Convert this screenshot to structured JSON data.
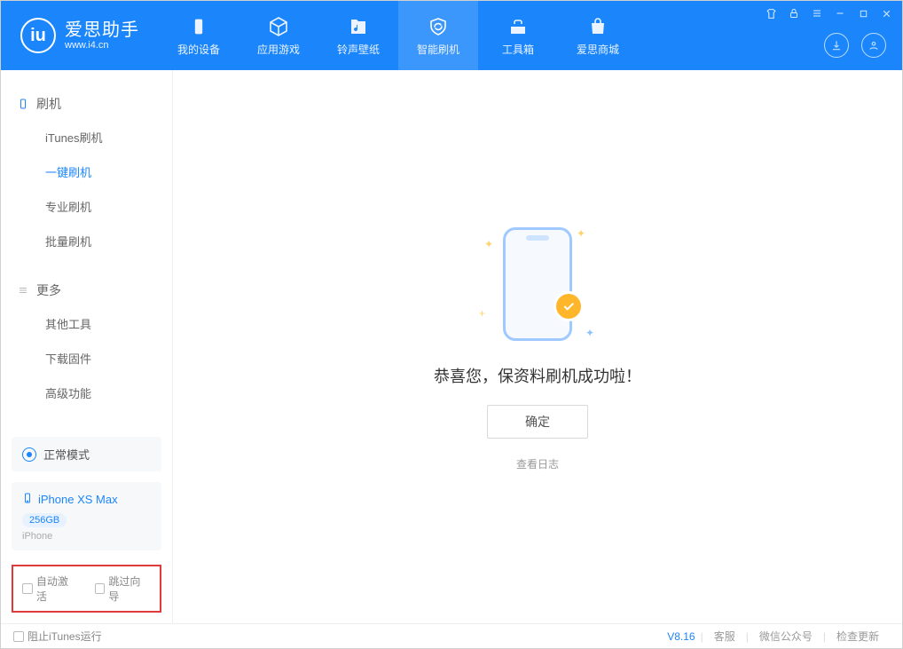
{
  "app": {
    "name_cn": "爱思助手",
    "name_en": "www.i4.cn"
  },
  "nav": {
    "items": [
      {
        "label": "我的设备"
      },
      {
        "label": "应用游戏"
      },
      {
        "label": "铃声壁纸"
      },
      {
        "label": "智能刷机"
      },
      {
        "label": "工具箱"
      },
      {
        "label": "爱思商城"
      }
    ],
    "active_index": 3
  },
  "sidebar": {
    "group1_title": "刷机",
    "group1_items": [
      "iTunes刷机",
      "一键刷机",
      "专业刷机",
      "批量刷机"
    ],
    "group1_active_index": 1,
    "group2_title": "更多",
    "group2_items": [
      "其他工具",
      "下载固件",
      "高级功能"
    ]
  },
  "mode": {
    "label": "正常模式"
  },
  "device": {
    "name": "iPhone XS Max",
    "capacity": "256GB",
    "type": "iPhone"
  },
  "options": {
    "auto_activate": "自动激活",
    "skip_guide": "跳过向导"
  },
  "main": {
    "success_text": "恭喜您，保资料刷机成功啦！",
    "ok_button": "确定",
    "view_log": "查看日志"
  },
  "footer": {
    "block_itunes": "阻止iTunes运行",
    "version": "V8.16",
    "links": [
      "客服",
      "微信公众号",
      "检查更新"
    ]
  }
}
